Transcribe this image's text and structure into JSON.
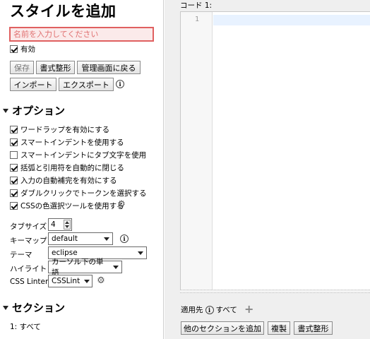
{
  "sidebar": {
    "title": "スタイルを追加",
    "name_placeholder": "名前を入力してください",
    "enabled_label": "有効",
    "buttons": {
      "save": "保存",
      "format": "書式整形",
      "back": "管理画面に戻る",
      "import": "インポート",
      "export": "エクスポート"
    },
    "options": {
      "heading": "オプション",
      "checkboxes": [
        {
          "label": "ワードラップを有効にする",
          "checked": true
        },
        {
          "label": "スマートインデントを使用する",
          "checked": true
        },
        {
          "label": "スマートインデントにタブ文字を使用",
          "checked": false
        },
        {
          "label": "括弧と引用符を自動的に閉じる",
          "checked": true
        },
        {
          "label": "入力の自動補完を有効にする",
          "checked": true
        },
        {
          "label": "ダブルクリックでトークンを選択する",
          "checked": true
        },
        {
          "label": "CSSの色選択ツールを使用する",
          "checked": true
        }
      ],
      "tab_size_label": "タブサイズ",
      "tab_size_value": "4",
      "keymap_label": "キーマップ",
      "keymap_value": "default",
      "theme_label": "テーマ",
      "theme_value": "eclipse",
      "highlight_label": "ハイライト",
      "highlight_value": "カーソル下の単語",
      "linter_label": "CSS Linter",
      "linter_value": "CSSLint"
    },
    "sections": {
      "heading": "セクション",
      "item": "1: すべて"
    }
  },
  "main": {
    "code_label": "コード 1:",
    "line_number": "1",
    "applies_label": "適用先",
    "applies_value": "すべて",
    "buttons": {
      "add_section": "他のセクションを追加",
      "duplicate": "複製",
      "format": "書式整形"
    }
  },
  "colors": {
    "error_border": "#e06060",
    "error_bg": "#fbeaea",
    "main_bg": "#efefef",
    "active_line": "#e8f2ff"
  },
  "icons": [
    "info-icon",
    "gear-icon",
    "plus-icon",
    "chevron-down-icon",
    "triangle-down-icon"
  ]
}
